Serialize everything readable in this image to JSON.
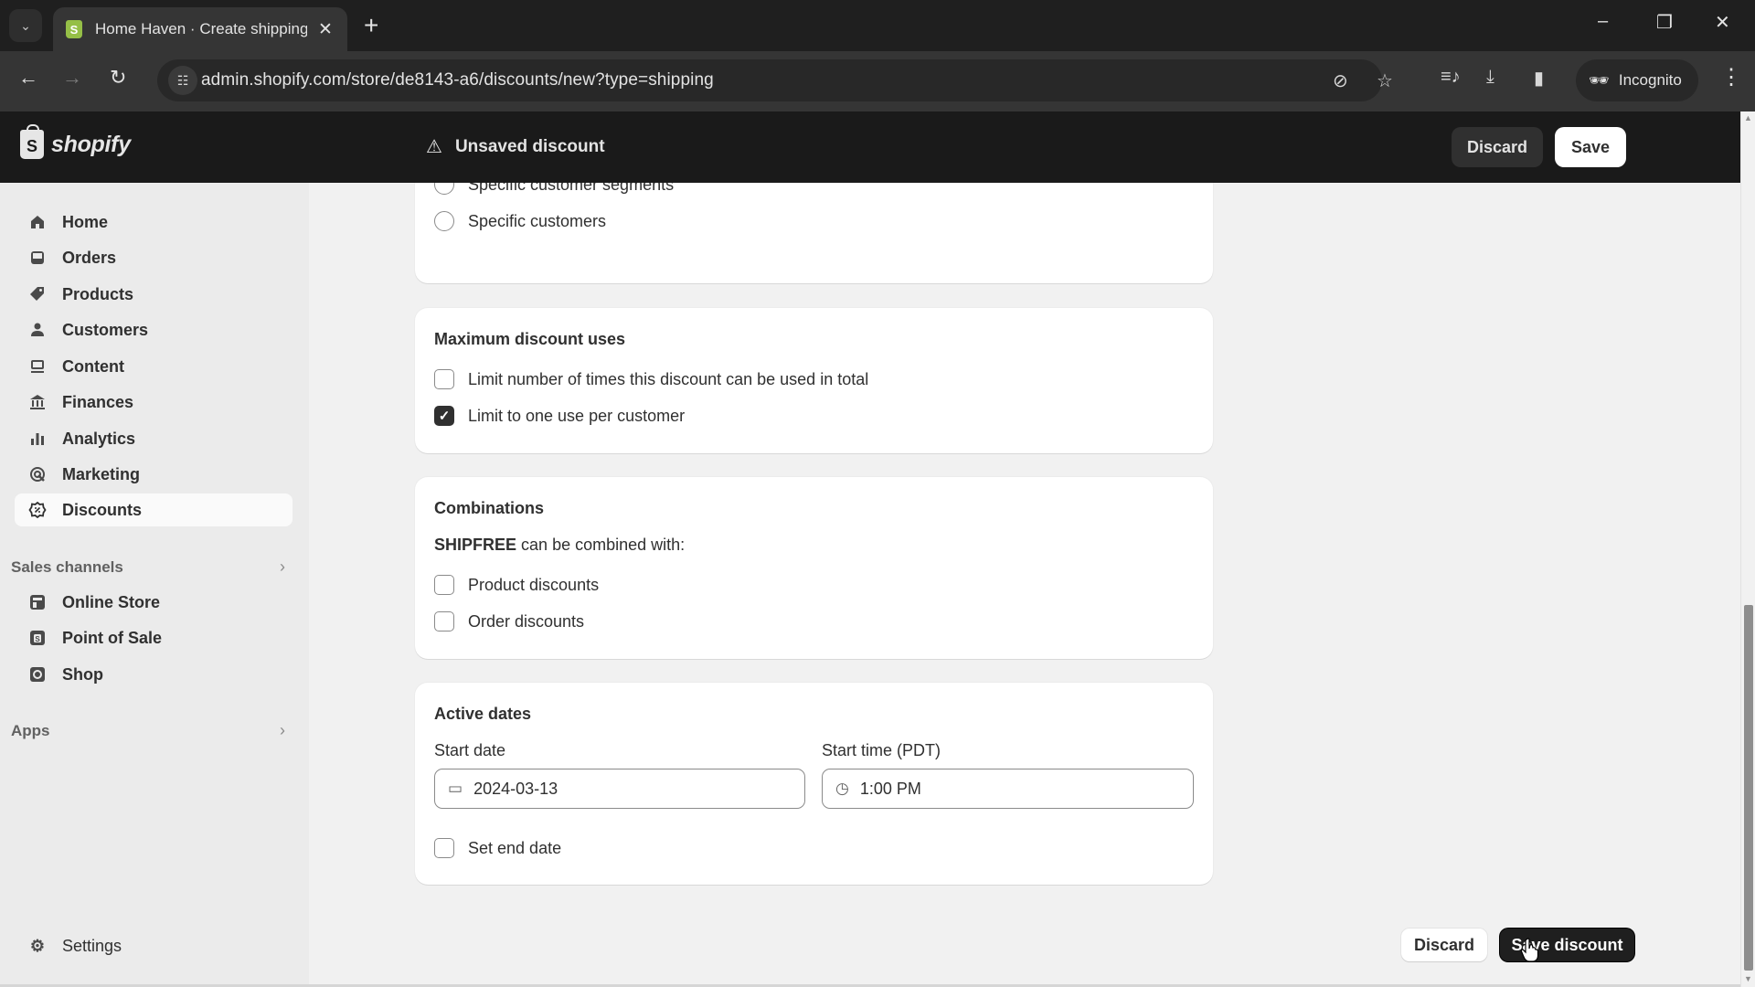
{
  "browser": {
    "tab_title": "Home Haven · Create shipping",
    "url": "admin.shopify.com/store/de8143-a6/discounts/new?type=shipping",
    "incognito_label": "Incognito",
    "icons": {
      "tab_search": "chevron-down-icon",
      "close_tab": "close-icon",
      "new_tab": "plus-icon",
      "back": "arrow-left-icon",
      "forward": "arrow-right-icon",
      "reload": "reload-icon",
      "site_info": "tune-icon",
      "eye_off": "eye-off-icon",
      "bookmark": "star-icon",
      "media": "media-control-icon",
      "download": "download-icon",
      "side_panel": "side-panel-icon",
      "incognito": "incognito-icon",
      "menu": "kebab-menu-icon",
      "minimize": "minimize-icon",
      "restore": "restore-icon",
      "close_window": "close-icon"
    }
  },
  "topbar": {
    "logo_text": "shopify",
    "status_text": "Unsaved discount",
    "discard_label": "Discard",
    "save_label": "Save"
  },
  "sidebar": {
    "items": [
      {
        "label": "Home",
        "icon": "home-icon"
      },
      {
        "label": "Orders",
        "icon": "inbox-icon"
      },
      {
        "label": "Products",
        "icon": "tag-icon"
      },
      {
        "label": "Customers",
        "icon": "person-icon"
      },
      {
        "label": "Content",
        "icon": "image-icon"
      },
      {
        "label": "Finances",
        "icon": "bank-icon"
      },
      {
        "label": "Analytics",
        "icon": "bar-chart-icon"
      },
      {
        "label": "Marketing",
        "icon": "target-icon"
      },
      {
        "label": "Discounts",
        "icon": "discount-icon",
        "active": true
      }
    ],
    "sales_channels": {
      "heading": "Sales channels",
      "items": [
        {
          "label": "Online Store",
          "icon": "store-icon"
        },
        {
          "label": "Point of Sale",
          "icon": "pos-icon"
        },
        {
          "label": "Shop",
          "icon": "shop-icon"
        }
      ]
    },
    "apps_heading": "Apps",
    "settings_label": "Settings"
  },
  "eligibility": {
    "options": [
      {
        "label": "Specific customer segments",
        "selected": false
      },
      {
        "label": "Specific customers",
        "selected": false
      }
    ]
  },
  "max_uses": {
    "title": "Maximum discount uses",
    "options": [
      {
        "label": "Limit number of times this discount can be used in total",
        "checked": false
      },
      {
        "label": "Limit to one use per customer",
        "checked": true
      }
    ]
  },
  "combinations": {
    "title": "Combinations",
    "code": "SHIPFREE",
    "description": "can be combined with:",
    "options": [
      {
        "label": "Product discounts",
        "checked": false
      },
      {
        "label": "Order discounts",
        "checked": false
      }
    ]
  },
  "active_dates": {
    "title": "Active dates",
    "start_date_label": "Start date",
    "start_date_value": "2024-03-13",
    "start_time_label": "Start time (PDT)",
    "start_time_value": "1:00 PM",
    "end_date_label": "Set end date",
    "end_date_checked": false
  },
  "footer": {
    "discard_label": "Discard",
    "save_label": "Save discount"
  }
}
